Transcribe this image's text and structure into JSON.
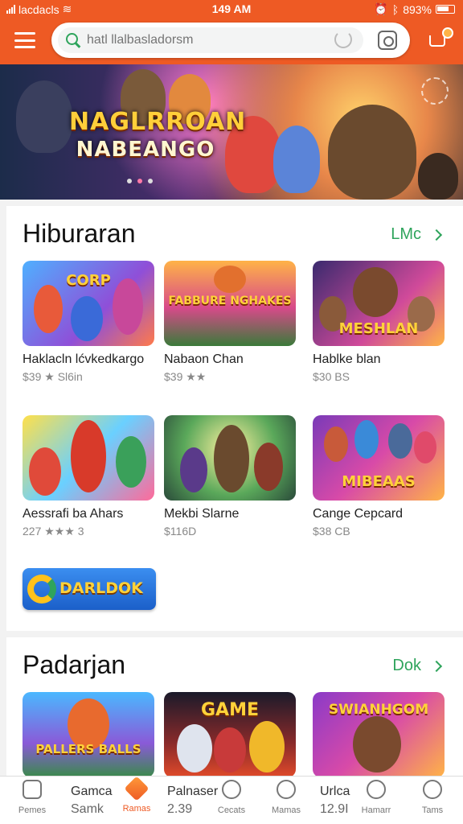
{
  "status_bar": {
    "carrier": "lacdacls",
    "time": "149 AM",
    "battery": "893%"
  },
  "search": {
    "placeholder": "hatl llalbasladorsm"
  },
  "hero": {
    "title_line1": "NAGLRROAN",
    "title_line2": "NABEANGO"
  },
  "section1": {
    "title": "Hiburaran",
    "more_label": "LMc",
    "cards": [
      {
        "name": "Haklacln lćvkedkargo",
        "meta": "$39 ★ Sl6in",
        "art_word": "CORP"
      },
      {
        "name": "Nabaon Chan",
        "meta": "$39 ★★",
        "art_word": "FABBURE NGHAKES"
      },
      {
        "name": "Hablke blan",
        "meta": "$30 BS",
        "art_word": "MESHLAN"
      },
      {
        "name": "Aessrafi ba Ahars",
        "meta": "227 ★★★ 3",
        "art_word": ""
      },
      {
        "name": "Mekbi Slarne",
        "meta": "$116D",
        "art_word": ""
      },
      {
        "name": "Cange Cepcard",
        "meta": "$38 CB",
        "art_word": "MIBEAAS"
      }
    ],
    "promo_label": "DARLDOK"
  },
  "section2": {
    "title": "Padarjan",
    "more_label": "Dok",
    "cards": [
      {
        "art_word": "PALLERS BALLS"
      },
      {
        "art_word": "GAME"
      },
      {
        "art_word": "SWIANHGOM"
      }
    ]
  },
  "bottom_nav": {
    "items": [
      {
        "label": "Pemes"
      },
      {
        "label": "Ramas"
      },
      {
        "label": "Cecats"
      },
      {
        "label": "Mamas"
      },
      {
        "label": "Hamarr"
      },
      {
        "label": "Tams"
      }
    ],
    "text_blocks": [
      {
        "title": "Gamca",
        "sub": "Samk"
      },
      {
        "title": "Palnaser",
        "sub": "2.39"
      },
      {
        "title": "Urlca",
        "sub": "12.9I"
      }
    ]
  }
}
